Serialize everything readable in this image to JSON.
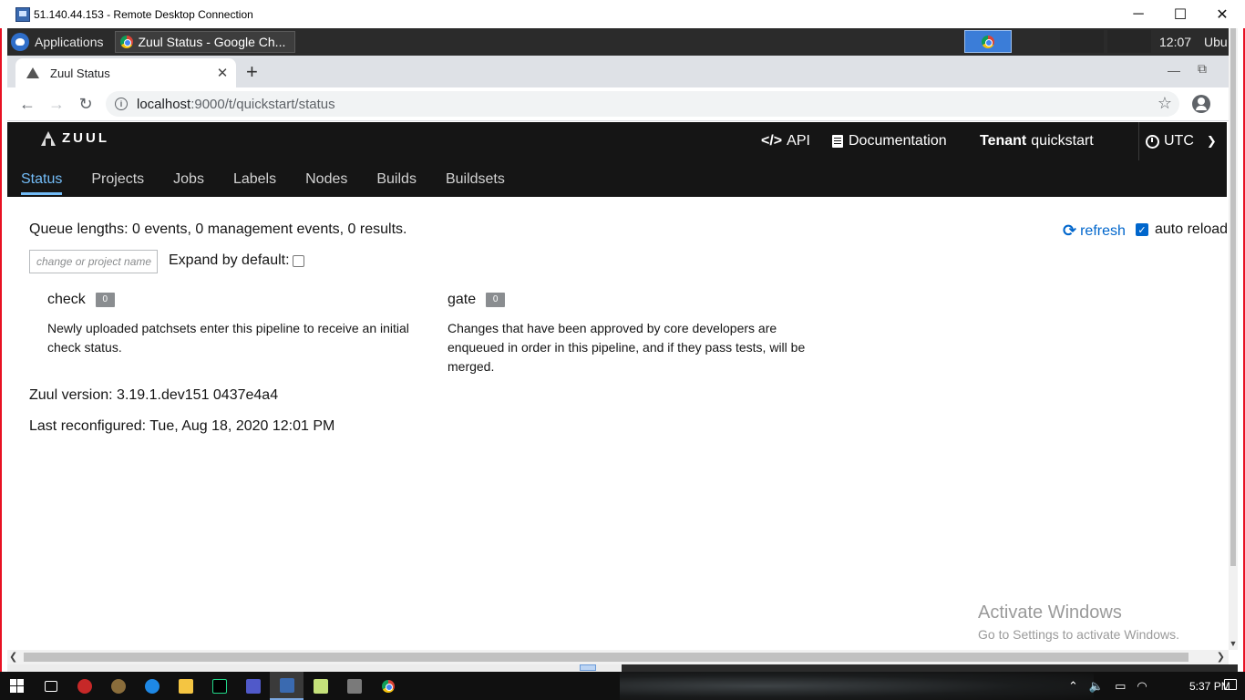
{
  "rdc": {
    "title": "51.140.44.153 - Remote Desktop Connection",
    "minimize": "─",
    "maximize": "☐",
    "close": "✕"
  },
  "xfce": {
    "applications_label": "Applications",
    "task_label": "Zuul Status - Google Ch...",
    "clock": "12:07",
    "user": "Ubu"
  },
  "browser": {
    "tab_title": "Zuul Status",
    "tab_close": "✕",
    "new_tab": "+",
    "url_host": "localhost",
    "url_path": ":9000/t/quickstart/status",
    "back": "←",
    "forward": "→",
    "reload": "↻",
    "star": "☆",
    "win_minimize": "—",
    "win_restore": "⧉"
  },
  "zuul": {
    "logo_text": "ZUUL",
    "header_links": {
      "api": "API",
      "documentation": "Documentation",
      "tenant_label": "Tenant",
      "tenant_name": "quickstart",
      "timezone": "UTC"
    },
    "nav": [
      {
        "label": "Status",
        "active": true
      },
      {
        "label": "Projects",
        "active": false
      },
      {
        "label": "Jobs",
        "active": false
      },
      {
        "label": "Labels",
        "active": false
      },
      {
        "label": "Nodes",
        "active": false
      },
      {
        "label": "Builds",
        "active": false
      },
      {
        "label": "Buildsets",
        "active": false
      }
    ],
    "queue_lengths": "Queue lengths: 0 events, 0 management events, 0 results.",
    "refresh_label": "refresh",
    "auto_reload_label": "auto reload",
    "auto_reload_checked": true,
    "filter_placeholder": "change or project name",
    "filter_value": "",
    "expand_label": "Expand by default:",
    "expand_checked": false,
    "pipelines": [
      {
        "name": "check",
        "count": "0",
        "description": "Newly uploaded patchsets enter this pipeline to receive an initial check status."
      },
      {
        "name": "gate",
        "count": "0",
        "description": "Changes that have been approved by core developers are enqueued in order in this pipeline, and if they pass tests, will be merged."
      }
    ],
    "version": "Zuul version: 3.19.1.dev151 0437e4a4",
    "last_reconfigured": "Last reconfigured: Tue, Aug 18, 2020 12:01 PM"
  },
  "watermark": {
    "line1": "Activate Windows",
    "line2": "Go to Settings to activate Windows."
  },
  "taskbar": {
    "time": "5:37 PM"
  },
  "colors": {
    "zuul_header_bg": "#151515",
    "nav_active": "#73bcf7",
    "link_blue": "#0066cc",
    "rdc_border": "#e81123",
    "badge_gray": "#8a8d90"
  }
}
